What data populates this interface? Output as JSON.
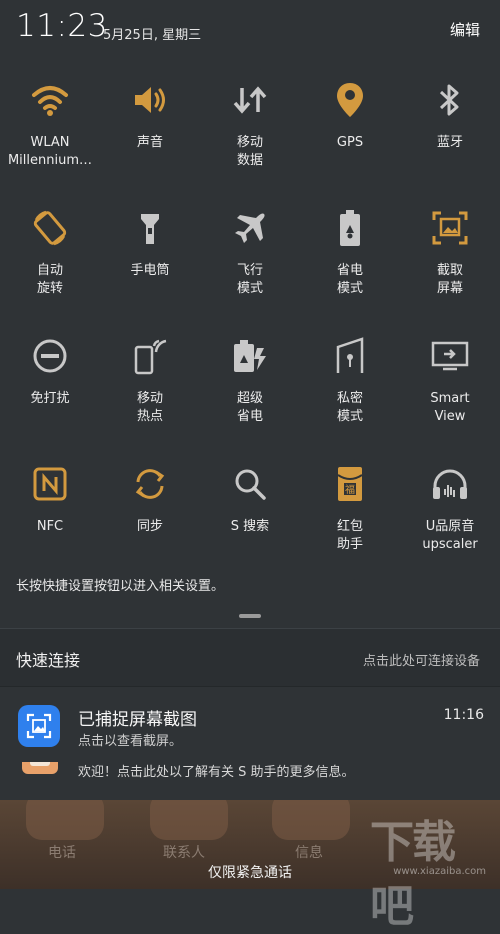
{
  "status": {
    "time": "11:23",
    "date": "5月25日, 星期三",
    "edit": "编辑"
  },
  "tiles": [
    {
      "label": "WLAN\nMillennium…",
      "icon": "wifi-icon",
      "on": true
    },
    {
      "label": "声音",
      "icon": "speaker-icon",
      "on": true
    },
    {
      "label": "移动\n数据",
      "icon": "mobile-data-icon",
      "on": false
    },
    {
      "label": "GPS",
      "icon": "location-pin-icon",
      "on": true
    },
    {
      "label": "蓝牙",
      "icon": "bluetooth-icon",
      "on": false
    },
    {
      "label": "自动\n旋转",
      "icon": "auto-rotate-icon",
      "on": true
    },
    {
      "label": "手电筒",
      "icon": "flashlight-icon",
      "on": false
    },
    {
      "label": "飞行\n模式",
      "icon": "airplane-icon",
      "on": false
    },
    {
      "label": "省电\n模式",
      "icon": "power-saving-battery-icon",
      "on": false
    },
    {
      "label": "截取\n屏幕",
      "icon": "screenshot-icon",
      "on": true
    },
    {
      "label": "免打扰",
      "icon": "do-not-disturb-icon",
      "on": false
    },
    {
      "label": "移动\n热点",
      "icon": "mobile-hotspot-icon",
      "on": false
    },
    {
      "label": "超级\n省电",
      "icon": "ultra-power-saving-icon",
      "on": false
    },
    {
      "label": "私密\n模式",
      "icon": "private-mode-icon",
      "on": false
    },
    {
      "label": "Smart\nView",
      "icon": "smart-view-icon",
      "on": false
    },
    {
      "label": "NFC",
      "icon": "nfc-icon",
      "on": true
    },
    {
      "label": "同步",
      "icon": "sync-icon",
      "on": true
    },
    {
      "label": "S 搜索",
      "icon": "search-icon",
      "on": false
    },
    {
      "label": "红包\n助手",
      "icon": "red-envelope-icon",
      "on": true
    },
    {
      "label": "U品原音\nupscaler",
      "icon": "headphones-icon",
      "on": false
    }
  ],
  "hint": "长按快捷设置按钮以进入相关设置。",
  "quick_connect": {
    "title": "快速连接",
    "action": "点击此处可连接设备"
  },
  "notification": {
    "title": "已捕捉屏幕截图",
    "subtitle": "点击以查看截屏。",
    "time": "11:16"
  },
  "notification2": {
    "text": "欢迎！点击此处以了解有关 S 助手的更多信息。"
  },
  "dock": {
    "items": [
      "电话",
      "联系人",
      "信息"
    ],
    "emergency": "仅限紧急通话"
  },
  "watermark": {
    "text": "下载吧",
    "url": "www.xiazaiba.com"
  },
  "colors": {
    "accent": "#d39a3f",
    "panel": "#2f3336",
    "inactive": "#c8c8c8"
  }
}
